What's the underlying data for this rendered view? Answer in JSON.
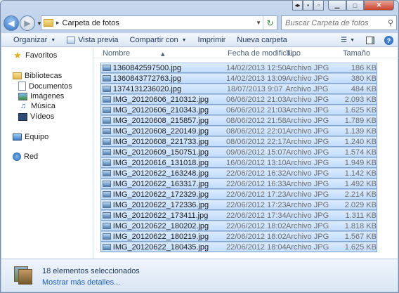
{
  "window": {
    "address_path": "Carpeta de fotos",
    "search_placeholder": "Buscar Carpeta de fotos"
  },
  "toolbar": {
    "organize": "Organizar",
    "slideshow": "Vista previa",
    "share": "Compartir con",
    "print": "Imprimir",
    "new_folder": "Nueva carpeta"
  },
  "nav": {
    "favorites": "Favoritos",
    "libraries": "Bibliotecas",
    "documents": "Documentos",
    "images": "Imágenes",
    "music": "Música",
    "videos": "Vídeos",
    "computer": "Equipo",
    "network": "Red"
  },
  "columns": {
    "name": "Nombre",
    "date": "Fecha de modifica...",
    "type": "Tipo",
    "size": "Tamaño"
  },
  "files": [
    {
      "name": "1360842597500.jpg",
      "date": "14/02/2013 12:50",
      "type": "Archivo JPG",
      "size": "186 KB"
    },
    {
      "name": "1360843772763.jpg",
      "date": "14/02/2013 13:09",
      "type": "Archivo JPG",
      "size": "380 KB"
    },
    {
      "name": "1374131236020.jpg",
      "date": "18/07/2013 9:07",
      "type": "Archivo JPG",
      "size": "484 KB"
    },
    {
      "name": "IMG_20120606_210312.jpg",
      "date": "06/06/2012 21:03",
      "type": "Archivo JPG",
      "size": "2.093 KB"
    },
    {
      "name": "IMG_20120606_210343.jpg",
      "date": "06/06/2012 21:03",
      "type": "Archivo JPG",
      "size": "1.625 KB"
    },
    {
      "name": "IMG_20120608_215857.jpg",
      "date": "08/06/2012 21:58",
      "type": "Archivo JPG",
      "size": "1.789 KB"
    },
    {
      "name": "IMG_20120608_220149.jpg",
      "date": "08/06/2012 22:01",
      "type": "Archivo JPG",
      "size": "1.139 KB"
    },
    {
      "name": "IMG_20120608_221733.jpg",
      "date": "08/06/2012 22:17",
      "type": "Archivo JPG",
      "size": "1.240 KB"
    },
    {
      "name": "IMG_20120609_150751.jpg",
      "date": "09/06/2012 15:07",
      "type": "Archivo JPG",
      "size": "1.574 KB"
    },
    {
      "name": "IMG_20120616_131018.jpg",
      "date": "16/06/2012 13:10",
      "type": "Archivo JPG",
      "size": "1.949 KB"
    },
    {
      "name": "IMG_20120622_163248.jpg",
      "date": "22/06/2012 16:32",
      "type": "Archivo JPG",
      "size": "1.142 KB"
    },
    {
      "name": "IMG_20120622_163317.jpg",
      "date": "22/06/2012 16:33",
      "type": "Archivo JPG",
      "size": "1.492 KB"
    },
    {
      "name": "IMG_20120622_172329.jpg",
      "date": "22/06/2012 17:23",
      "type": "Archivo JPG",
      "size": "2.214 KB"
    },
    {
      "name": "IMG_20120622_172336.jpg",
      "date": "22/06/2012 17:23",
      "type": "Archivo JPG",
      "size": "2.029 KB"
    },
    {
      "name": "IMG_20120622_173411.jpg",
      "date": "22/06/2012 17:34",
      "type": "Archivo JPG",
      "size": "1.311 KB"
    },
    {
      "name": "IMG_20120622_180202.jpg",
      "date": "22/06/2012 18:02",
      "type": "Archivo JPG",
      "size": "1.818 KB"
    },
    {
      "name": "IMG_20120622_180219.jpg",
      "date": "22/06/2012 18:02",
      "type": "Archivo JPG",
      "size": "1.567 KB"
    },
    {
      "name": "IMG_20120622_180435.jpg",
      "date": "22/06/2012 18:04",
      "type": "Archivo JPG",
      "size": "1.625 KB"
    }
  ],
  "details": {
    "selection": "18 elementos seleccionados",
    "more": "Mostrar más detalles..."
  },
  "colors": {
    "selection_fill": "#cde3fc",
    "selection_border": "#7da2ce",
    "link": "#1d5fb4"
  }
}
